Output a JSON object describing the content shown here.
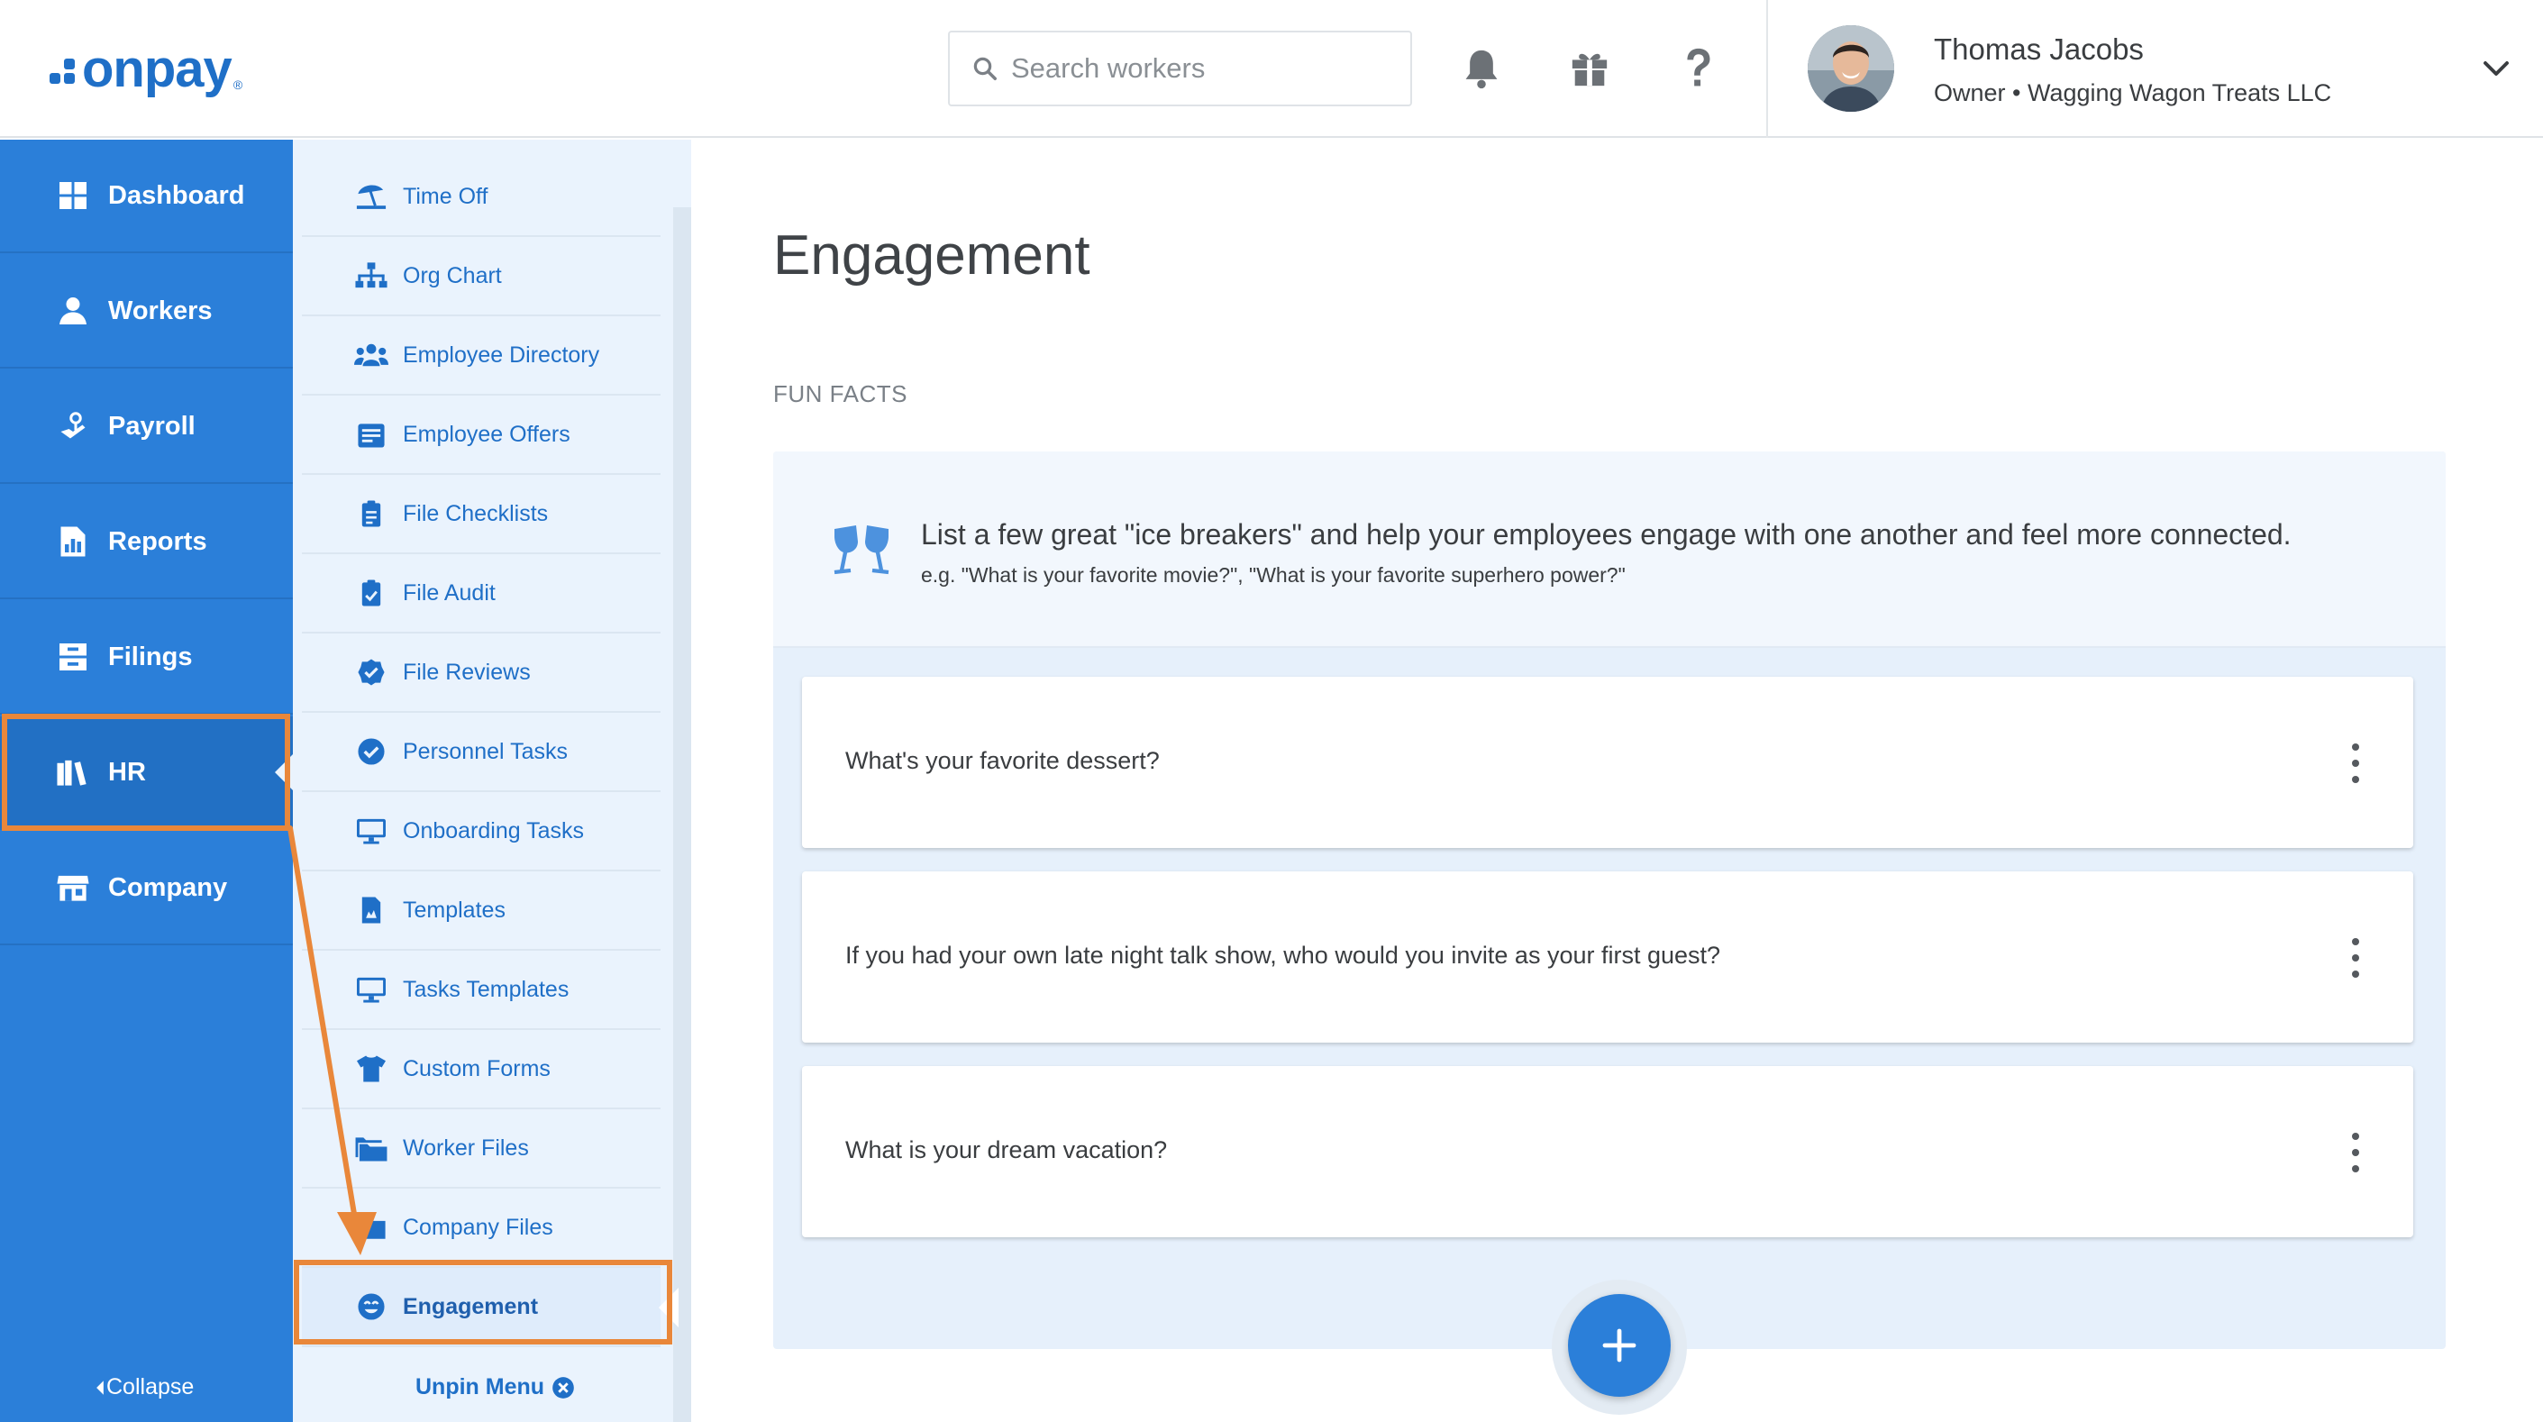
{
  "header": {
    "logo_text": "onpay",
    "logo_reg": "®",
    "search_placeholder": "Search workers",
    "icons": [
      "bell-icon",
      "gift-icon",
      "help-icon"
    ],
    "user": {
      "name": "Thomas Jacobs",
      "role": "Owner • Wagging Wagon Treats LLC"
    }
  },
  "sidebar": {
    "items": [
      {
        "label": "Dashboard",
        "icon": "dashboard-icon"
      },
      {
        "label": "Workers",
        "icon": "workers-icon"
      },
      {
        "label": "Payroll",
        "icon": "payroll-icon"
      },
      {
        "label": "Reports",
        "icon": "reports-icon"
      },
      {
        "label": "Filings",
        "icon": "filings-icon"
      },
      {
        "label": "HR",
        "icon": "hr-icon",
        "active": true
      },
      {
        "label": "Company",
        "icon": "company-icon"
      }
    ],
    "collapse_label": "Collapse"
  },
  "submenu": {
    "items": [
      {
        "label": "Time Off",
        "icon": "beach-umbrella-icon"
      },
      {
        "label": "Org Chart",
        "icon": "org-chart-icon"
      },
      {
        "label": "Employee Directory",
        "icon": "people-icon"
      },
      {
        "label": "Employee Offers",
        "icon": "offer-icon"
      },
      {
        "label": "File Checklists",
        "icon": "clipboard-icon"
      },
      {
        "label": "File Audit",
        "icon": "clipboard-check-icon"
      },
      {
        "label": "File Reviews",
        "icon": "badge-check-icon"
      },
      {
        "label": "Personnel Tasks",
        "icon": "check-circle-icon"
      },
      {
        "label": "Onboarding Tasks",
        "icon": "monitor-icon"
      },
      {
        "label": "Templates",
        "icon": "document-icon"
      },
      {
        "label": "Tasks Templates",
        "icon": "monitor-icon"
      },
      {
        "label": "Custom Forms",
        "icon": "shirt-icon"
      },
      {
        "label": "Worker Files",
        "icon": "folders-icon"
      },
      {
        "label": "Company Files",
        "icon": "folder-icon"
      },
      {
        "label": "Engagement",
        "icon": "smile-icon",
        "active": true
      }
    ],
    "unpin_label": "Unpin Menu"
  },
  "main": {
    "title": "Engagement",
    "section_label": "FUN FACTS",
    "intro": {
      "text": "List a few great \"ice breakers\" and help your employees engage with one another and feel more connected.",
      "example": "e.g. \"What is your favorite movie?\", \"What is your favorite superhero power?\""
    },
    "questions": [
      "What's your favorite dessert?",
      "If you had your own late night talk show, who would you invite as your first guest?",
      "What is your dream vacation?"
    ]
  },
  "colors": {
    "brand_blue": "#2b7fd9",
    "highlight_orange": "#e9873a",
    "submenu_bg": "#eaf3fd"
  }
}
